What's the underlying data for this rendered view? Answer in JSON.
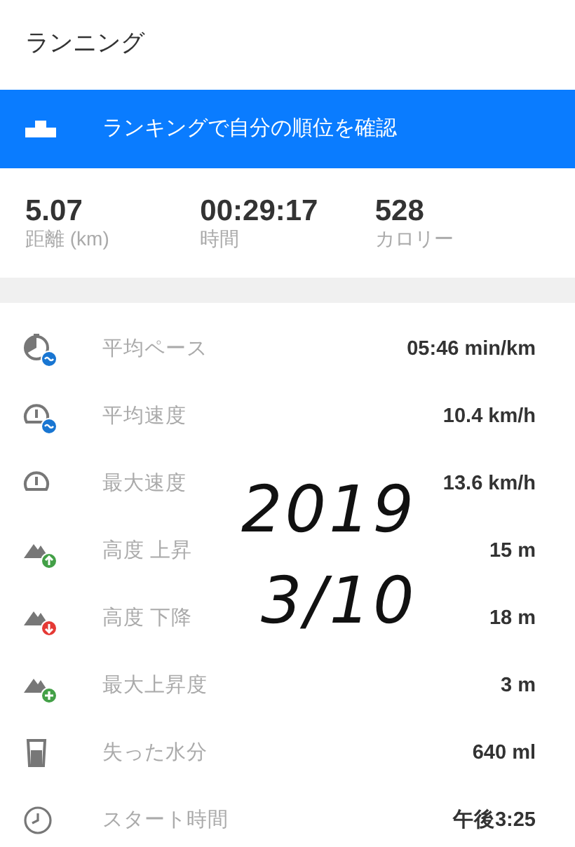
{
  "title": "ランニング",
  "banner": {
    "text": "ランキングで自分の順位を確認"
  },
  "summary": [
    {
      "value": "5.07",
      "label": "距離 (km)"
    },
    {
      "value": "00:29:17",
      "label": "時間"
    },
    {
      "value": "528",
      "label": "カロリー"
    }
  ],
  "metrics": [
    {
      "kind": "pace",
      "label": "平均ペース",
      "value": "05:46 min/km"
    },
    {
      "kind": "avg-speed",
      "label": "平均速度",
      "value": "10.4 km/h"
    },
    {
      "kind": "max-speed",
      "label": "最大速度",
      "value": "13.6 km/h"
    },
    {
      "kind": "ascent",
      "label": "高度 上昇",
      "value": "15 m"
    },
    {
      "kind": "descent",
      "label": "高度 下降",
      "value": "18 m"
    },
    {
      "kind": "max-ascent",
      "label": "最大上昇度",
      "value": "3 m"
    },
    {
      "kind": "water",
      "label": "失った水分",
      "value": "640 ml"
    },
    {
      "kind": "clock",
      "label": "スタート時間",
      "value": "午後3:25"
    }
  ],
  "handwriting": [
    "2019",
    "3/10"
  ]
}
